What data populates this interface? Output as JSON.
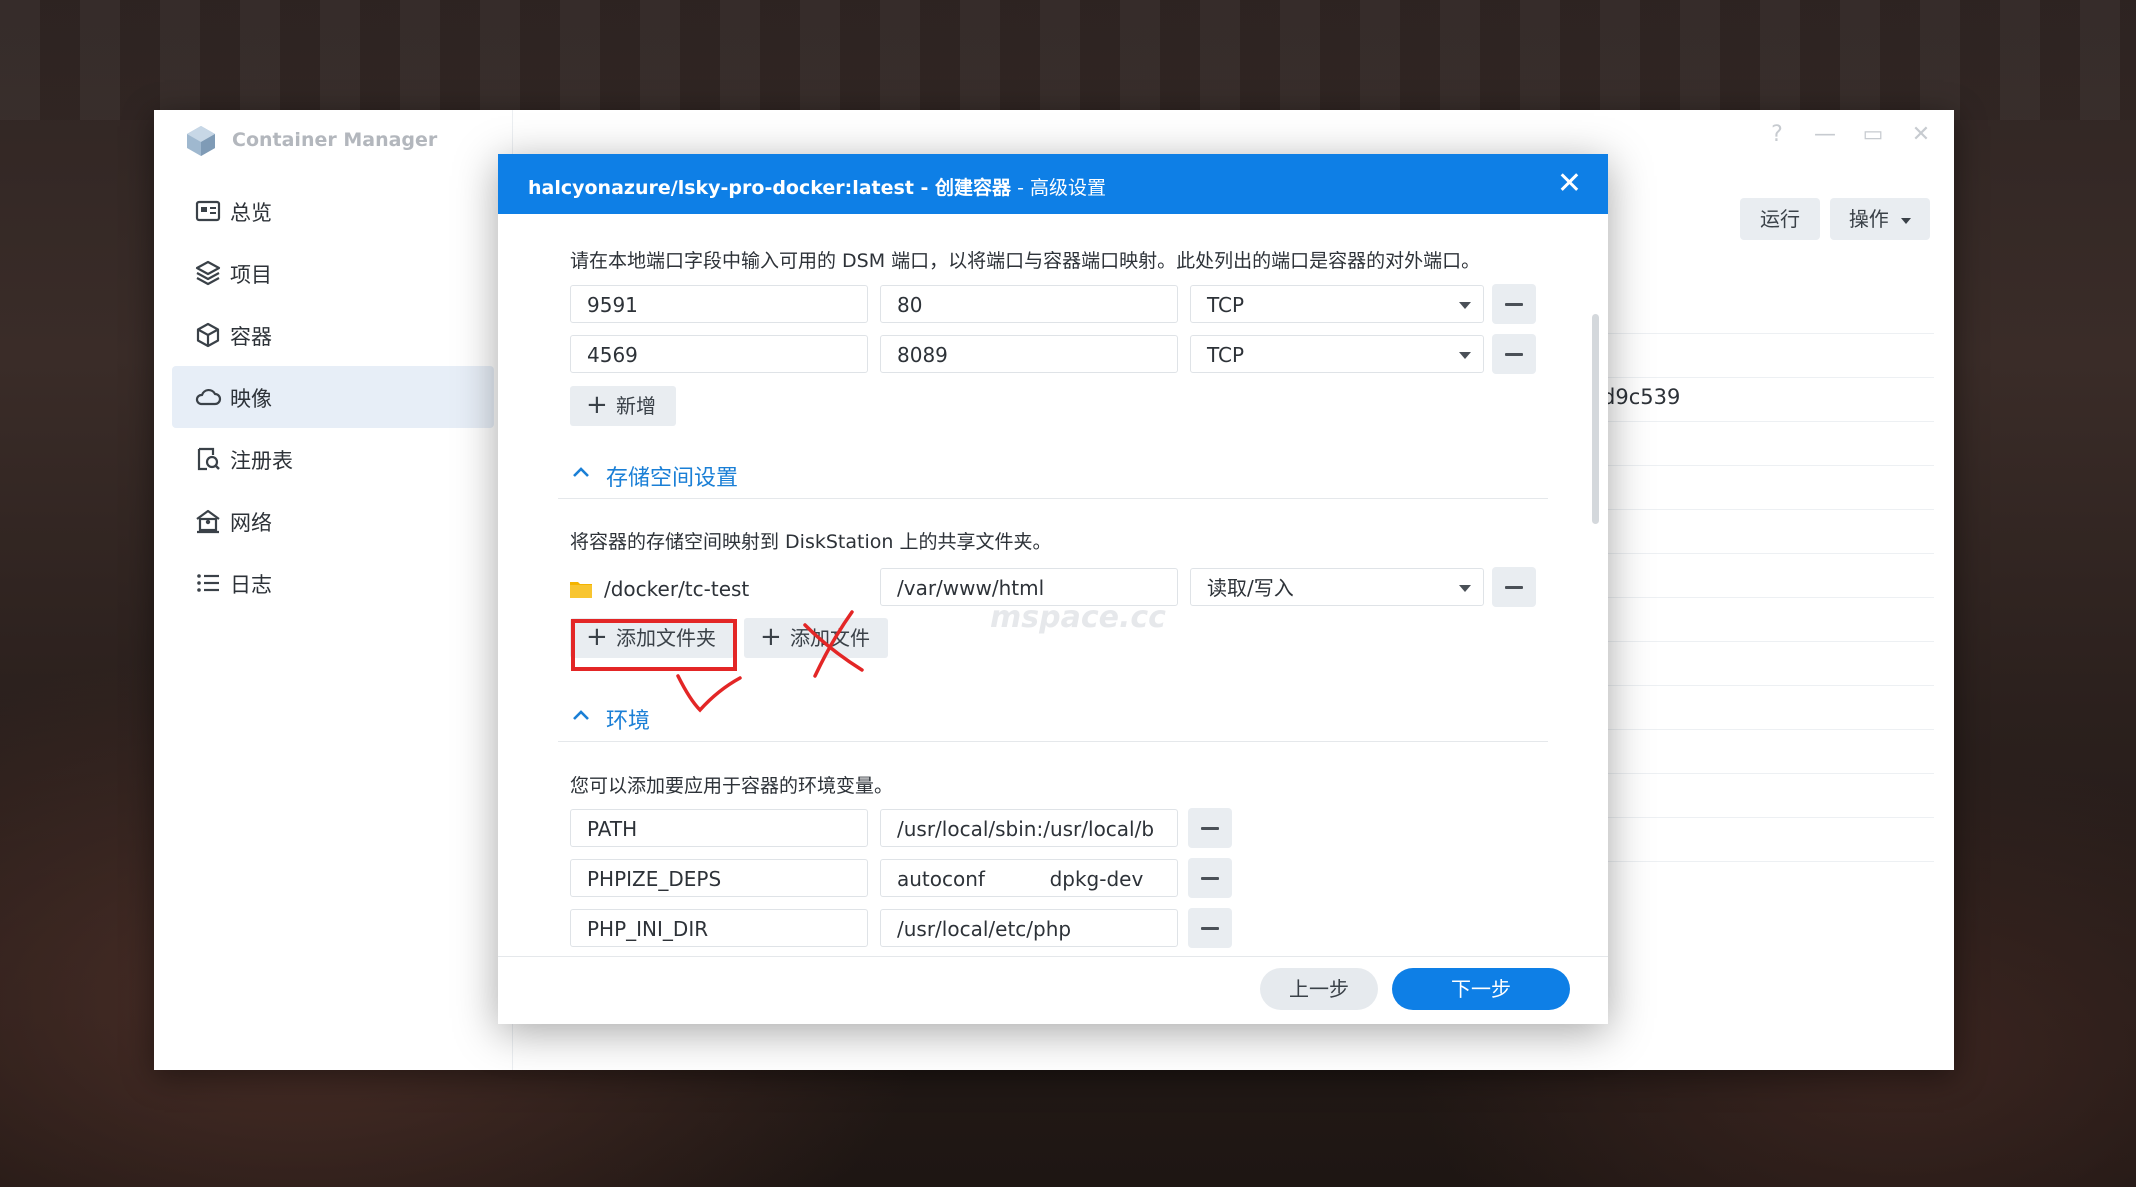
{
  "app": {
    "title": "Container Manager",
    "window_controls": [
      "?",
      "—",
      "▭",
      "✕"
    ]
  },
  "sidebar": {
    "items": [
      {
        "label": "总览",
        "icon": "overview-icon"
      },
      {
        "label": "项目",
        "icon": "layers-icon"
      },
      {
        "label": "容器",
        "icon": "cube-icon"
      },
      {
        "label": "映像",
        "icon": "cloud-icon",
        "active": true
      },
      {
        "label": "注册表",
        "icon": "registry-search-icon"
      },
      {
        "label": "网络",
        "icon": "network-icon"
      },
      {
        "label": "日志",
        "icon": "list-icon"
      }
    ]
  },
  "toolbar": {
    "run_label": "运行",
    "action_label": "操作"
  },
  "background": {
    "partial_id": "d9c539"
  },
  "modal": {
    "title_main": "halcyonazure/lsky-pro-docker:latest - 创建容器",
    "title_sep": " - ",
    "title_sub": "高级设置",
    "ports": {
      "description": "请在本地端口字段中输入可用的 DSM 端口，以将端口与容器端口映射。此处列出的端口是容器的对外端口。",
      "rows": [
        {
          "local": "9591",
          "container": "80",
          "protocol": "TCP"
        },
        {
          "local": "4569",
          "container": "8089",
          "protocol": "TCP"
        }
      ],
      "add_label": "新增"
    },
    "storage": {
      "heading": "存储空间设置",
      "description": "将容器的存储空间映射到 DiskStation 上的共享文件夹。",
      "rows": [
        {
          "folder": "/docker/tc-test",
          "mount": "/var/www/html",
          "mode": "读取/写入"
        }
      ],
      "add_folder_label": "添加文件夹",
      "add_file_label": "添加文件"
    },
    "environment": {
      "heading": "环境",
      "description": "您可以添加要应用于容器的环境变量。",
      "rows": [
        {
          "key": "PATH",
          "value": "/usr/local/sbin:/usr/local/b"
        },
        {
          "key": "PHPIZE_DEPS",
          "value": "autoconf \t\tdpkg-dev"
        },
        {
          "key": "PHP_INI_DIR",
          "value": "/usr/local/etc/php"
        }
      ]
    },
    "footer": {
      "prev_label": "上一步",
      "next_label": "下一步"
    }
  },
  "watermark": "mspace.cc",
  "colors": {
    "accent": "#0e7fe6",
    "annotation": "#e32626",
    "heading": "#1a7fd6"
  }
}
